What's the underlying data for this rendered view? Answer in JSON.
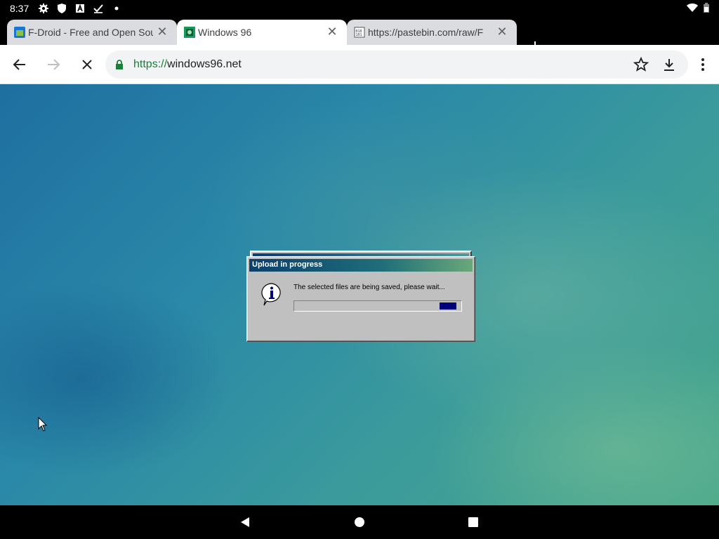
{
  "status_bar": {
    "time": "8:37",
    "icons": [
      "settings-icon",
      "shield-icon",
      "a-icon",
      "check-icon",
      "dot-icon"
    ],
    "right_icons": [
      "wifi-icon",
      "battery-icon"
    ]
  },
  "tabs": [
    {
      "title": "F-Droid - Free and Open Sour",
      "favicon": "fdroid-favicon",
      "active": false
    },
    {
      "title": "Windows 96",
      "favicon": "windows96-favicon",
      "active": true
    },
    {
      "title": "https://pastebin.com/raw/F",
      "favicon": "pastebin-favicon",
      "active": false
    }
  ],
  "toolbar": {
    "url_scheme": "https://",
    "url_host": "windows96.net"
  },
  "dialog": {
    "title": "Upload in progress",
    "message": "The selected files are being saved, please wait...",
    "progress_marquee": true
  },
  "colors": {
    "titlebar_start": "#0b3f6b",
    "titlebar_end": "#6aa87a",
    "progress_fill": "#00007b",
    "url_scheme": "#188038"
  }
}
